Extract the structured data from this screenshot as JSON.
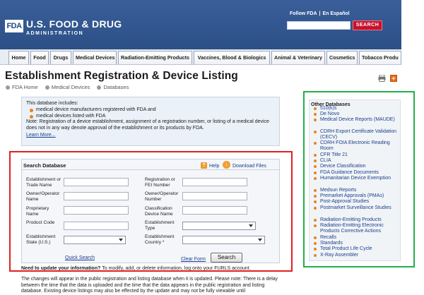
{
  "header": {
    "logo": "FDA",
    "agency_line1": "U.S. FOOD & DRUG",
    "agency_line2": "ADMINISTRATION",
    "follow_link": "Follow FDA",
    "separator": "|",
    "spanish_link": "En Español",
    "search_placeholder": "",
    "search_button": "SEARCH"
  },
  "nav": {
    "tabs": [
      "Home",
      "Food",
      "Drugs",
      "Medical Devices",
      "Radiation-Emitting Products",
      "Vaccines, Blood & Biologics",
      "Animal & Veterinary",
      "Cosmetics",
      "Tobacco Produ"
    ]
  },
  "page": {
    "title": "Establishment Registration & Device Listing",
    "breadcrumb": [
      "FDA Home",
      "Medical Devices",
      "Databases"
    ]
  },
  "info": {
    "intro": "This database includes:",
    "bullets": [
      "medical device manufacturers registered with FDA and",
      "medical devices listed with FDA"
    ],
    "note": "Note: Registration of a device establishment, assignment of a registration number, or listing of a medical device does not in any way denote approval of the establishment or its products by FDA.",
    "learn_more": "Learn More..."
  },
  "search_panel": {
    "title": "Search Database",
    "help": "Help",
    "download": "Download Files",
    "fields": {
      "establishment_name": "Establishment or Trade Name",
      "registration_number": "Registration or FEI Number",
      "owner_operator_name": "Owner/Operator Name",
      "owner_operator_number": "Owner/Operator Number",
      "proprietary_name": "Proprietary Name",
      "classification_device_name": "Classification Device Name",
      "product_code": "Product Code",
      "establishment_type": "Establishment Type",
      "establishment_state": "Establishment State (U.S.)",
      "establishment_country": "Establishment Country *"
    },
    "quick_search": "Quick Search",
    "clear_form": "Clear Form",
    "search_button": "Search"
  },
  "update": {
    "bold": "Need to update your information?",
    "rest": " To modify, add, or delete information, log onto your FURLS account."
  },
  "changes": "The changes will appear in the public registration and listing database when it is updated. Please note: There is a delay between the time that the data is uploaded and the time that the data appears in the public registration and listing database. Existing device listings may also be effected by the update and may not be fully viewable until",
  "sidebar": {
    "title": "Other Databases",
    "items": [
      "510(k)s",
      "De Novo",
      "Medical Device Reports (MAUDE)",
      "CDRH Export Certificate Validation (CECV)",
      "CDRH FOIA Electronic Reading Room",
      "CFR Title 21",
      "CLIA",
      "Device Classification",
      "FDA Guidance Documents",
      "Humanitarian Device Exemption",
      "Medsun Reports",
      "Premarket Approvals (PMAs)",
      "Post-Approval Studies",
      "Postmarket Surveillance Studies",
      "Radiation-Emitting Products",
      "Radiation-Emitting Electronic Products Corrective Actions",
      "Recalls",
      "Standards",
      "Total Product Life Cycle",
      "X-Ray Assembler"
    ]
  },
  "colors": {
    "header_blue": "#2c4f86",
    "link_blue": "#1a3e8c",
    "bullet_orange": "#e6841e",
    "search_red": "#c8102e",
    "annotation_red": "#e02020",
    "annotation_green": "#22b04a"
  }
}
